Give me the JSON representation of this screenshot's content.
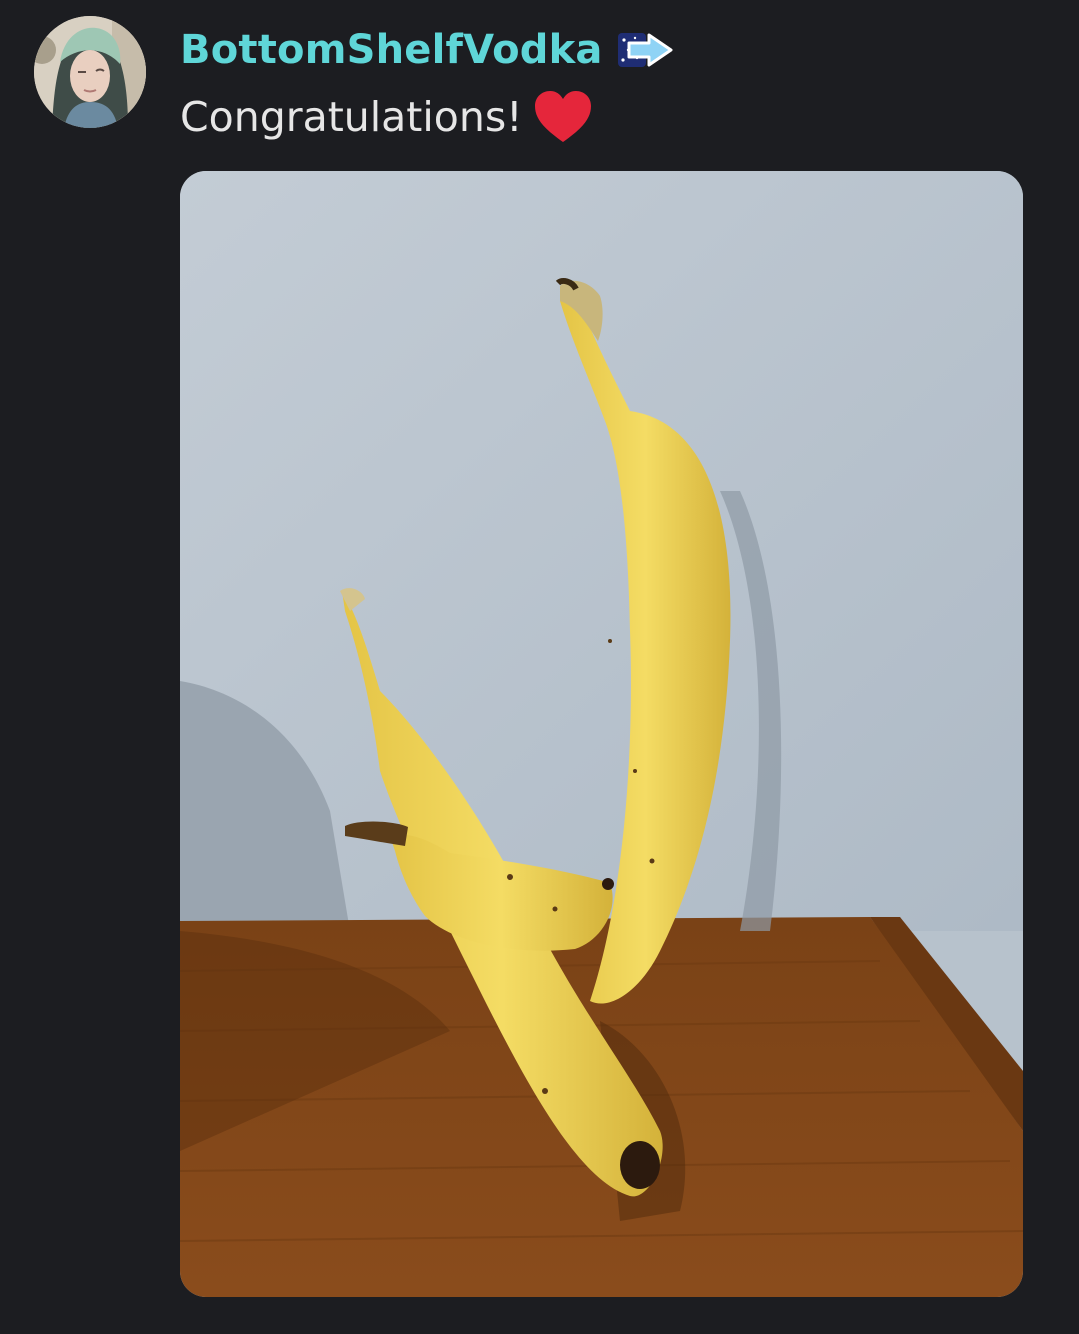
{
  "message": {
    "author": {
      "name": "BottomShelfVodka",
      "badge_icon": "arrow-right-icon"
    },
    "content": "Congratulations!",
    "reaction_icon": "red-heart-icon",
    "attachment": {
      "type": "image",
      "subject_icon": "bananas-photo"
    }
  },
  "colors": {
    "background": "#1c1d21",
    "username": "#5fd6d8",
    "text": "#e6e6e6",
    "heart": "#e5263b"
  }
}
